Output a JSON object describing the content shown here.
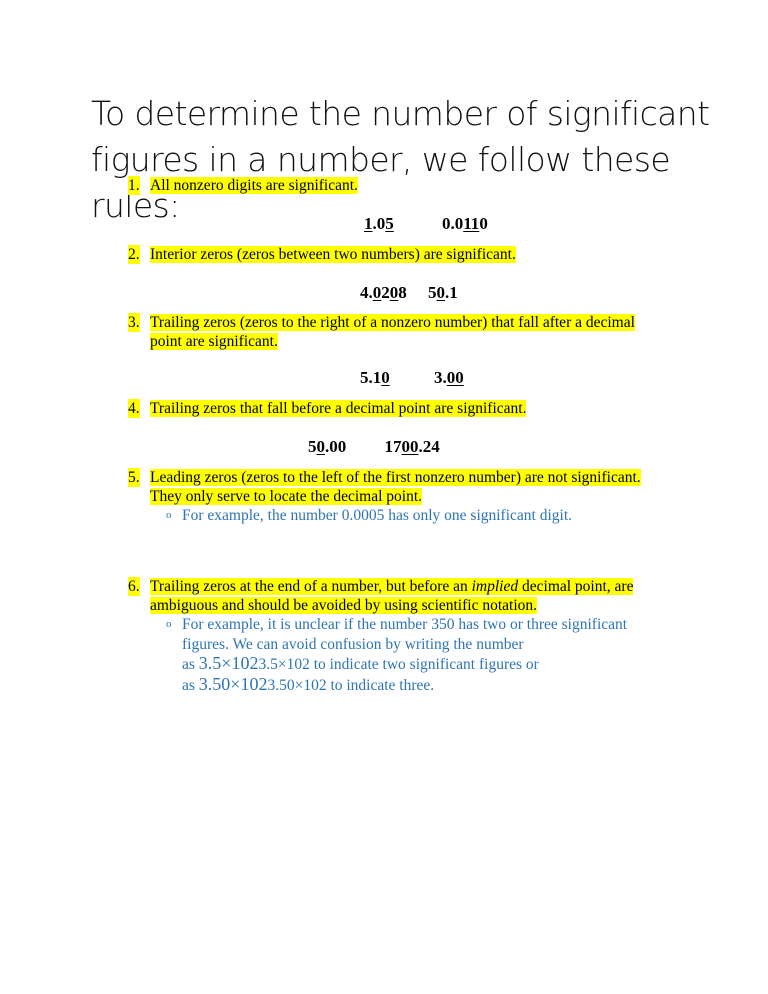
{
  "title": "To determine the number of significant figures in a number, we follow these rules:",
  "rules": [
    {
      "num": "1.",
      "text": "All nonzero digits are significant.",
      "examples": [
        {
          "parts": [
            {
              "t": "1",
              "u": true
            },
            {
              "t": ".0",
              "u": false
            },
            {
              "t": "5",
              "u": true
            }
          ]
        },
        {
          "parts": [
            {
              "t": "0.0",
              "u": false
            },
            {
              "t": "11",
              "u": true
            },
            {
              "t": "0",
              "u": false
            }
          ]
        }
      ]
    },
    {
      "num": "2.",
      "text": "Interior zeros (zeros between two numbers) are significant.",
      "examples": [
        {
          "parts": [
            {
              "t": "4.",
              "u": false
            },
            {
              "t": "0",
              "u": true
            },
            {
              "t": "2",
              "u": false
            },
            {
              "t": "0",
              "u": true
            },
            {
              "t": "8",
              "u": false
            }
          ]
        },
        {
          "parts": [
            {
              "t": "5",
              "u": false
            },
            {
              "t": "0",
              "u": true
            },
            {
              "t": ".1",
              "u": false
            }
          ]
        }
      ]
    },
    {
      "num": "3.",
      "text_line1": "Trailing zeros (zeros to the right of a nonzero number) that fall after a decimal",
      "text_line2": "point are significant.",
      "examples": [
        {
          "parts": [
            {
              "t": "5.1",
              "u": false
            },
            {
              "t": "0",
              "u": true
            }
          ]
        },
        {
          "parts": [
            {
              "t": "3.",
              "u": false
            },
            {
              "t": "00",
              "u": true
            }
          ]
        }
      ]
    },
    {
      "num": "4.",
      "text": "Trailing zeros that fall before a decimal point are significant.",
      "examples": [
        {
          "parts": [
            {
              "t": "5",
              "u": false
            },
            {
              "t": "0",
              "u": true
            },
            {
              "t": ".00",
              "u": false
            }
          ]
        },
        {
          "parts": [
            {
              "t": "17",
              "u": false
            },
            {
              "t": "00",
              "u": true
            },
            {
              "t": ".24",
              "u": false
            }
          ]
        }
      ]
    },
    {
      "num": "5.",
      "text_line1": "Leading zeros (zeros to the left of the first nonzero number) are not significant.",
      "text_line2": "They only serve to locate the decimal point.",
      "sub": "For example, the number 0.0005 has only one significant digit."
    },
    {
      "num": "6.",
      "text_pre": "Trailing zeros at the end of a number, but before an ",
      "text_em": "implied",
      "text_post": " decimal point, are",
      "text_line2": "ambiguous and should be avoided by using scientific notation.",
      "sub": {
        "line1": "For example, it is unclear if the number 350 has two or three significant",
        "line2": "figures. We can avoid confusion by writing the number",
        "line3_pre": "as ",
        "line3_big": "3.5×102",
        "line3_post": "3.5×102 to indicate two significant figures or",
        "line4_pre": "as ",
        "line4_big": "3.50×102",
        "line4_post": "3.50×102 to indicate three."
      }
    }
  ],
  "bullet_glyph": "o",
  "colors": {
    "highlight": "#ffff00",
    "sub_text": "#2e74b5"
  }
}
